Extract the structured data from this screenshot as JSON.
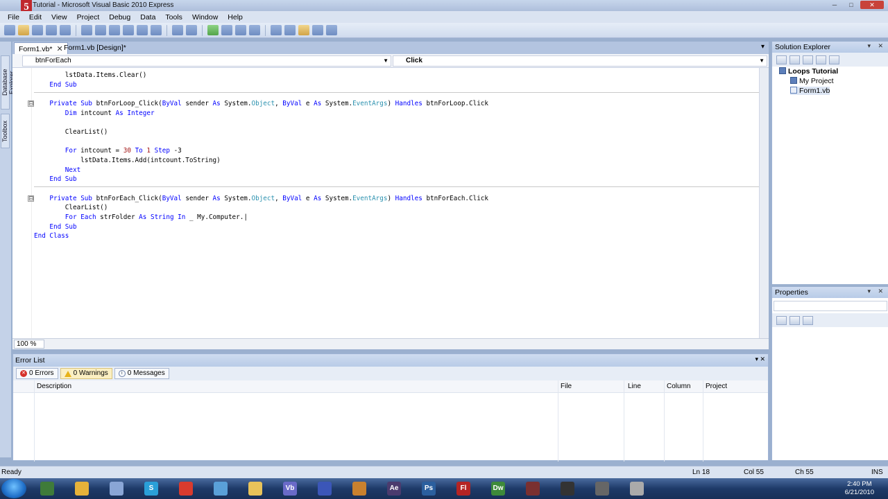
{
  "window": {
    "logo": "5",
    "title": "Tutorial - Microsoft Visual Basic 2010 Express",
    "minimize": "─",
    "maximize": "□",
    "close": "✕"
  },
  "menu": [
    "File",
    "Edit",
    "View",
    "Project",
    "Debug",
    "Data",
    "Tools",
    "Window",
    "Help"
  ],
  "side_tabs": [
    "Database Explorer",
    "Toolbox"
  ],
  "doc_tabs": [
    {
      "label": "Form1.vb*",
      "close": "✕"
    },
    {
      "label": "Form1.vb [Design]*"
    }
  ],
  "doc_tabs_dropdown": "▾",
  "nav": {
    "object": "btnForEach",
    "event": "Click"
  },
  "code": {
    "lines": [
      "        lstData.Items.Clear()",
      "    End Sub",
      "",
      "    Private Sub btnForLoop_Click(ByVal sender As System.Object, ByVal e As System.EventArgs) Handles btnForLoop.Click",
      "        Dim intcount As Integer",
      "",
      "        ClearList()",
      "",
      "        For intcount = 30 To 1 Step -3",
      "            lstData.Items.Add(intcount.ToString)",
      "        Next",
      "    End Sub",
      "",
      "    Private Sub btnForEach_Click(ByVal sender As System.Object, ByVal e As System.EventArgs) Handles btnForEach.Click",
      "        ClearList()",
      "        For Each strFolder As String In _ My.Computer.|",
      "    End Sub",
      "End Class"
    ],
    "fold_marks": [
      "⊟",
      "⊟"
    ]
  },
  "zoom": "100 %",
  "error_list": {
    "title": "Error List",
    "controls": "▾ ✕",
    "tabs": {
      "errors": "0 Errors",
      "warnings": "0 Warnings",
      "messages": "0 Messages"
    },
    "error_glyph": "✕",
    "message_glyph": "i",
    "columns": [
      "Description",
      "File",
      "Line",
      "Column",
      "Project"
    ]
  },
  "solution_explorer": {
    "title": "Solution Explorer",
    "controls": "▾ ✕",
    "items": [
      "Loops Tutorial",
      "My Project",
      "Form1.vb"
    ]
  },
  "properties": {
    "title": "Properties",
    "controls": "▾ ✕"
  },
  "status": {
    "state": "Ready",
    "line": "Ln 18",
    "col": "Col 55",
    "ch": "Ch 55",
    "mode": "INS"
  },
  "taskbar": {
    "apps": [
      {
        "label": "",
        "color": "#3f7b3a"
      },
      {
        "label": "",
        "color": "#e6b23a"
      },
      {
        "label": "",
        "color": "#8aa6d6"
      },
      {
        "label": "S",
        "color": "#2a9fd8"
      },
      {
        "label": "",
        "color": "#d93b2e"
      },
      {
        "label": "",
        "color": "#5aa0d8"
      },
      {
        "label": "",
        "color": "#e8c35a"
      },
      {
        "label": "Vb",
        "color": "#6a6ac8"
      },
      {
        "label": "",
        "color": "#3b56b8"
      },
      {
        "label": "",
        "color": "#c9812e"
      },
      {
        "label": "Ae",
        "color": "#4b3b6e"
      },
      {
        "label": "Ps",
        "color": "#2b5f9e"
      },
      {
        "label": "Fl",
        "color": "#b52424"
      },
      {
        "label": "Dw",
        "color": "#3e8a3a"
      },
      {
        "label": "",
        "color": "#7a3030"
      },
      {
        "label": "",
        "color": "#333333"
      },
      {
        "label": "",
        "color": "#666666"
      },
      {
        "label": "",
        "color": "#aaaaaa"
      }
    ],
    "time": "2:40 PM",
    "date": "6/21/2010"
  }
}
